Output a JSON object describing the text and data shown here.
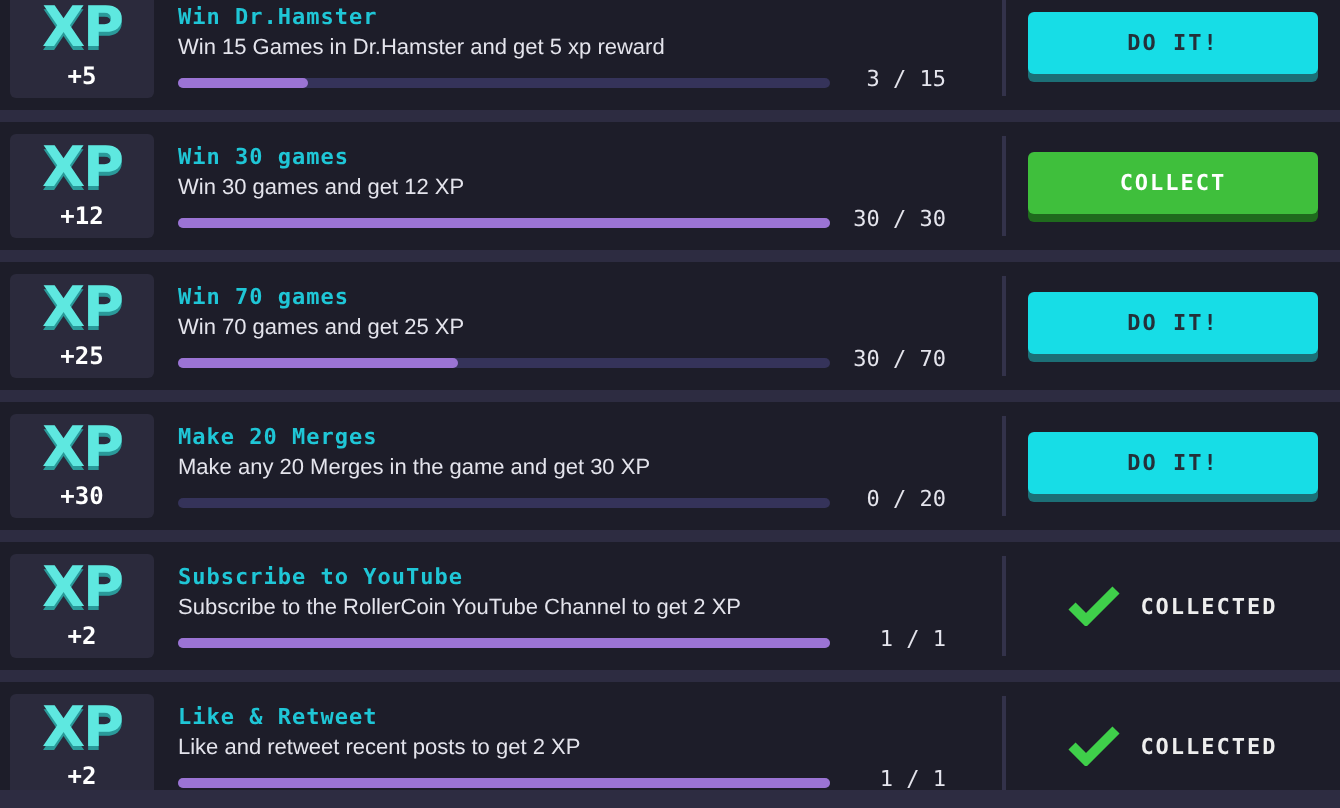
{
  "tasks": [
    {
      "logo": "XP",
      "xp": "+5",
      "title": "Win Dr.Hamster",
      "description": "Win 15 Games in Dr.Hamster and get 5 xp reward",
      "level": 0.2,
      "progress": "3 / 15",
      "action": {
        "kind": "do_it",
        "label": "DO IT!"
      }
    },
    {
      "logo": "XP",
      "xp": "+12",
      "title": "Win 30 games",
      "description": "Win 30 games and get 12 XP",
      "level": 1,
      "progress": "30 / 30",
      "action": {
        "kind": "collect",
        "label": "COLLECT"
      }
    },
    {
      "logo": "XP",
      "xp": "+25",
      "title": "Win 70 games",
      "description": "Win 70 games and get 25 XP",
      "level": 0.43,
      "progress": "30 / 70",
      "action": {
        "kind": "do_it",
        "label": "DO IT!"
      }
    },
    {
      "logo": "XP",
      "xp": "+30",
      "title": "Make 20 Merges",
      "description": "Make any 20 Merges in the game and get 30 XP",
      "level": 0,
      "progress": "0 / 20",
      "action": {
        "kind": "do_it",
        "label": "DO IT!"
      }
    },
    {
      "logo": "XP",
      "xp": "+2",
      "title": "Subscribe to YouTube",
      "description": "Subscribe to the RollerCoin YouTube Channel to get 2 XP",
      "level": 1,
      "progress": "1 / 1",
      "action": {
        "kind": "collected",
        "label": "COLLECTED"
      }
    },
    {
      "logo": "XP",
      "xp": "+2",
      "title": "Like & Retweet",
      "description": "Like and retweet recent posts to get 2 XP",
      "level": 1,
      "progress": "1 / 1",
      "action": {
        "kind": "collected",
        "label": "COLLECTED"
      }
    }
  ]
}
